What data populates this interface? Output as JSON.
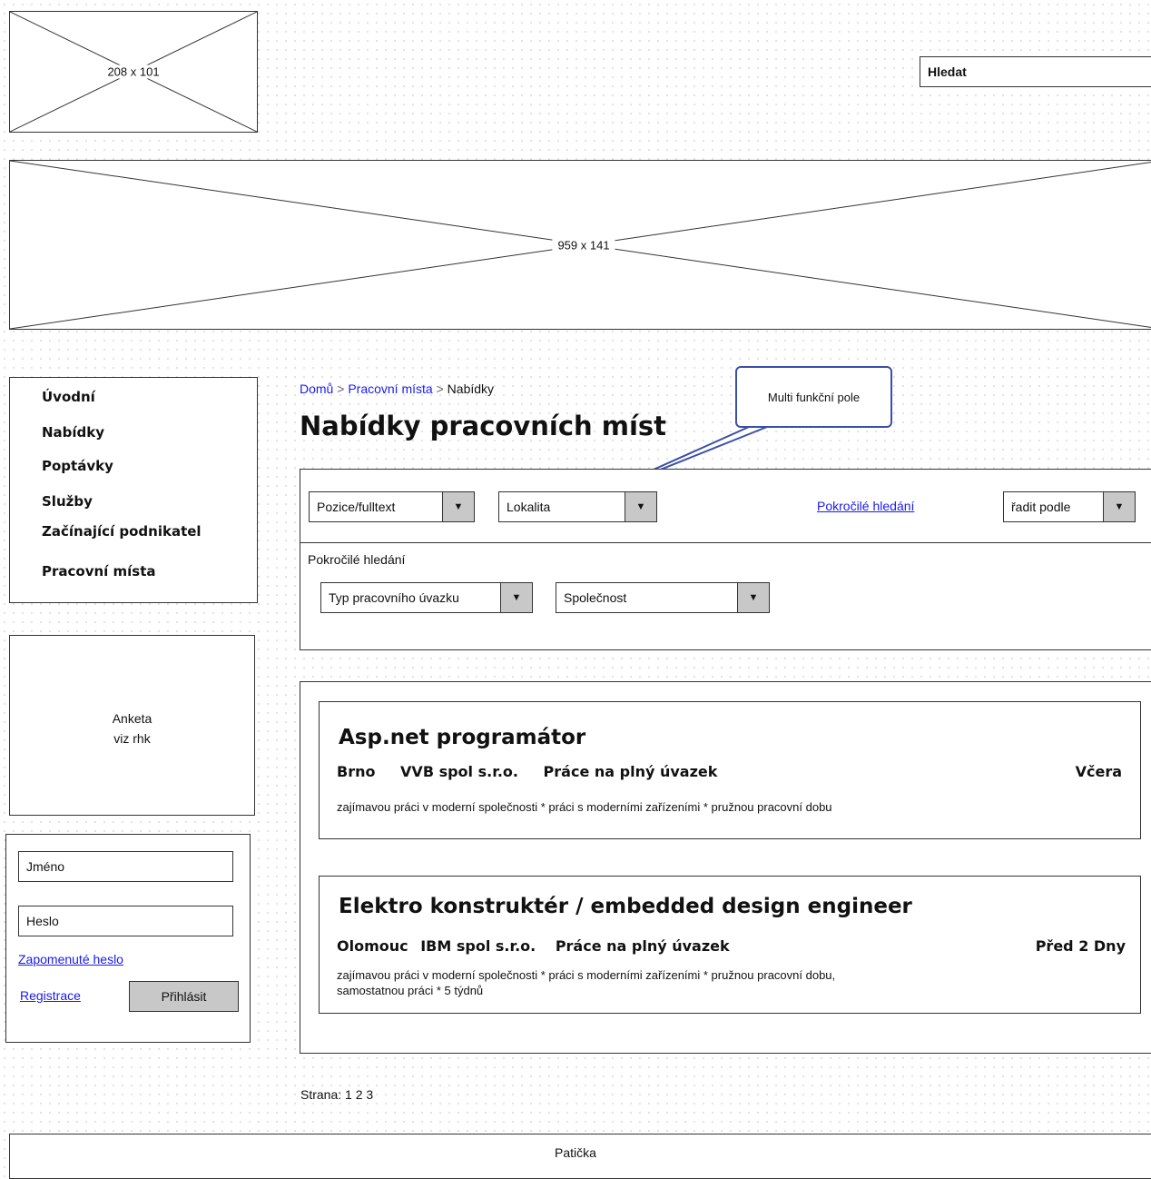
{
  "header": {
    "logo_placeholder": "208 x 101",
    "banner_placeholder": "959 x 141",
    "search_label": "Hledat"
  },
  "sidebar": {
    "nav": [
      "Úvodní",
      "Nabídky",
      "Poptávky",
      "Služby",
      "Začínající podnikatel",
      "Pracovní místa"
    ],
    "poll_line1": "Anketa",
    "poll_line2": "viz rhk",
    "login": {
      "name_label": "Jméno",
      "password_label": "Heslo",
      "forgot_link": "Zapomenuté heslo",
      "register_link": "Registrace",
      "login_button": "Přihlásit"
    }
  },
  "breadcrumb": {
    "home": "Domů",
    "sep1": ">",
    "jobs": "Pracovní místa",
    "sep2": ">",
    "current": "Nabídky"
  },
  "page_title": "Nabídky pracovních míst",
  "callout": "Multi funkční pole",
  "filters": {
    "position": "Pozice/fulltext",
    "location": "Lokalita",
    "advanced_link": "Pokročilé hledání",
    "sort": "řadit podle",
    "advanced_title": "Pokročilé hledání",
    "job_type": "Typ pracovního úvazku",
    "company": "Společnost",
    "arrow": "▼"
  },
  "jobs": [
    {
      "title": "Asp.net programátor",
      "city": "Brno",
      "company": "VVB spol s.r.o.",
      "type": "Práce na plný úvazek",
      "date": "Včera",
      "desc_line1": "zajímavou práci v moderní společnosti * práci s moderními zařízeními * pružnou pracovní dobu",
      "desc_line2": ""
    },
    {
      "title": "Elektro konstruktér / embedded design engineer",
      "city": "Olomouc",
      "company": "IBM spol s.r.o.",
      "type": "Práce na plný úvazek",
      "date": "Před 2 Dny",
      "desc_line1": "zajímavou práci v moderní společnosti * práci s moderními zařízeními * pružnou pracovní dobu,",
      "desc_line2": "samostatnou práci * 5 týdnů"
    }
  ],
  "pagination": {
    "label": "Strana:",
    "pages": [
      "1",
      "2",
      "3"
    ]
  },
  "footer": "Patička"
}
